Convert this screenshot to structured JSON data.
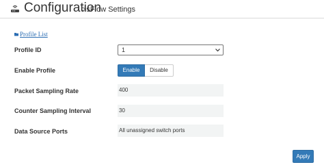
{
  "header": {
    "title": "Configuration",
    "subtitle": ">sFlow Settings",
    "icon": "router-icon"
  },
  "profile_list_link": "Profile List",
  "form": {
    "profile_id": {
      "label": "Profile ID",
      "value": "1"
    },
    "enable_profile": {
      "label": "Enable Profile",
      "enable_label": "Enable",
      "disable_label": "Disable",
      "selected": "Enable"
    },
    "packet_sampling_rate": {
      "label": "Packet Sampling Rate",
      "value": "400"
    },
    "counter_sampling_interval": {
      "label": "Counter Sampling Interval",
      "value": "30"
    },
    "data_source_ports": {
      "label": "Data Source Ports",
      "value": "All unassigned switch ports"
    }
  },
  "apply_label": "Apply",
  "colors": {
    "primary": "#337ab7",
    "link": "#2b6db3",
    "field_bg": "#f2f4f4"
  }
}
